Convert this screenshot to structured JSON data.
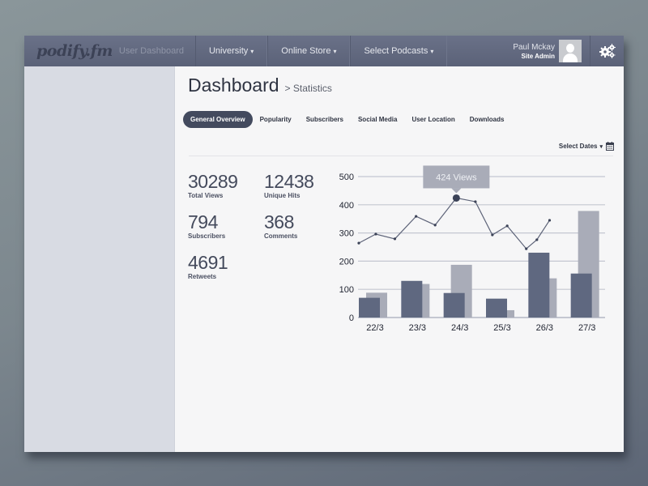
{
  "header": {
    "logo": "podify.fm",
    "subtitle": "User Dashboard",
    "nav": [
      {
        "label": "University"
      },
      {
        "label": "Online Store"
      },
      {
        "label": "Select Podcasts"
      }
    ],
    "user": {
      "name": "Paul Mckay",
      "role": "Site Admin"
    },
    "icons": {
      "avatar": "user-silhouette",
      "settings": "gears-icon",
      "caret": "▾"
    }
  },
  "page": {
    "title": "Dashboard",
    "breadcrumb": "> Statistics"
  },
  "tabs": [
    {
      "label": "General Overview",
      "active": true
    },
    {
      "label": "Popularity",
      "active": false
    },
    {
      "label": "Subscribers",
      "active": false
    },
    {
      "label": "Social Media",
      "active": false
    },
    {
      "label": "User Location",
      "active": false
    },
    {
      "label": "Downloads",
      "active": false
    }
  ],
  "date_select": {
    "label": "Select Dates",
    "icon": "calendar-icon"
  },
  "stats": [
    {
      "value": "30289",
      "label": "Total Views"
    },
    {
      "value": "12438",
      "label": "Unique Hits"
    },
    {
      "value": "794",
      "label": "Subscribers"
    },
    {
      "value": "368",
      "label": "Comments"
    },
    {
      "value": "4691",
      "label": "Retweets"
    }
  ],
  "colors": {
    "bar_dark": "#5f6880",
    "bar_light": "#a9acb8",
    "line": "#5d6378",
    "grid": "#c4c7d1",
    "tooltip_bg": "#a9acb8",
    "highlight_point": "#3b4257"
  },
  "chart_data": {
    "type": "bar+line",
    "title": "",
    "xlabel": "",
    "ylabel": "",
    "ylim": [
      0,
      500
    ],
    "yticks": [
      0,
      100,
      200,
      300,
      400,
      500
    ],
    "categories": [
      "22/3",
      "23/3",
      "24/3",
      "25/3",
      "26/3",
      "27/3"
    ],
    "series": [
      {
        "name": "bars-dark",
        "type": "bar",
        "values": [
          70,
          130,
          87,
          67,
          230,
          156
        ]
      },
      {
        "name": "bars-light",
        "type": "bar",
        "values": [
          88,
          119,
          187,
          26,
          139,
          378
        ]
      }
    ],
    "line": {
      "name": "views",
      "type": "line",
      "x": [
        0.0,
        0.4,
        0.85,
        1.35,
        1.8,
        2.3,
        2.75,
        3.15,
        3.5,
        3.95,
        4.2,
        4.5
      ],
      "values": [
        264,
        296,
        279,
        359,
        328,
        424,
        411,
        293,
        325,
        244,
        276,
        345
      ]
    },
    "highlight": {
      "index": 5,
      "label": "424 Views"
    },
    "grid": true,
    "legend": "none"
  }
}
